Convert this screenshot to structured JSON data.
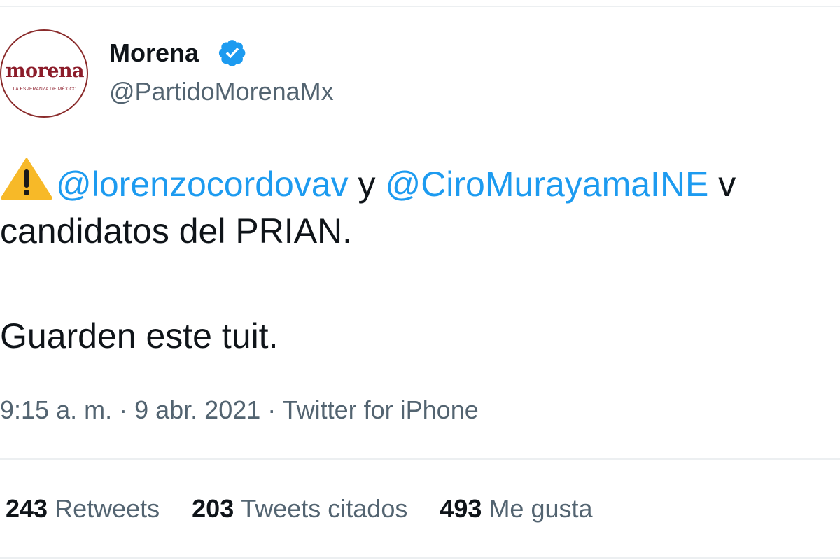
{
  "author": {
    "display_name": "Morena",
    "handle": "@PartidoMorenaMx",
    "verified": true,
    "avatar_logo_text": "morena",
    "avatar_tagline": "LA ESPERANZA DE MÉXICO"
  },
  "tweet": {
    "warning_icon": "warning-icon",
    "mention_1": "@lorenzocordovav",
    "connector": " y ",
    "mention_2": "@CiroMurayamaINE",
    "line1_tail": " v",
    "line2": "candidatos del PRIAN.",
    "line3": "Guarden este tuit."
  },
  "meta": {
    "time": "9:15 a. m.",
    "separator": " · ",
    "date": "9 abr. 2021",
    "source": "Twitter for iPhone"
  },
  "stats": {
    "retweets_count": "243",
    "retweets_label": "Retweets",
    "quotes_count": "203",
    "quotes_label": "Tweets citados",
    "likes_count": "493",
    "likes_label": "Me gusta"
  },
  "colors": {
    "text": "#0f1419",
    "secondary": "#536471",
    "link": "#1d9bf0",
    "verified": "#1d9bf0",
    "brand": "#8c1c2a",
    "warning": "#f7b928"
  }
}
